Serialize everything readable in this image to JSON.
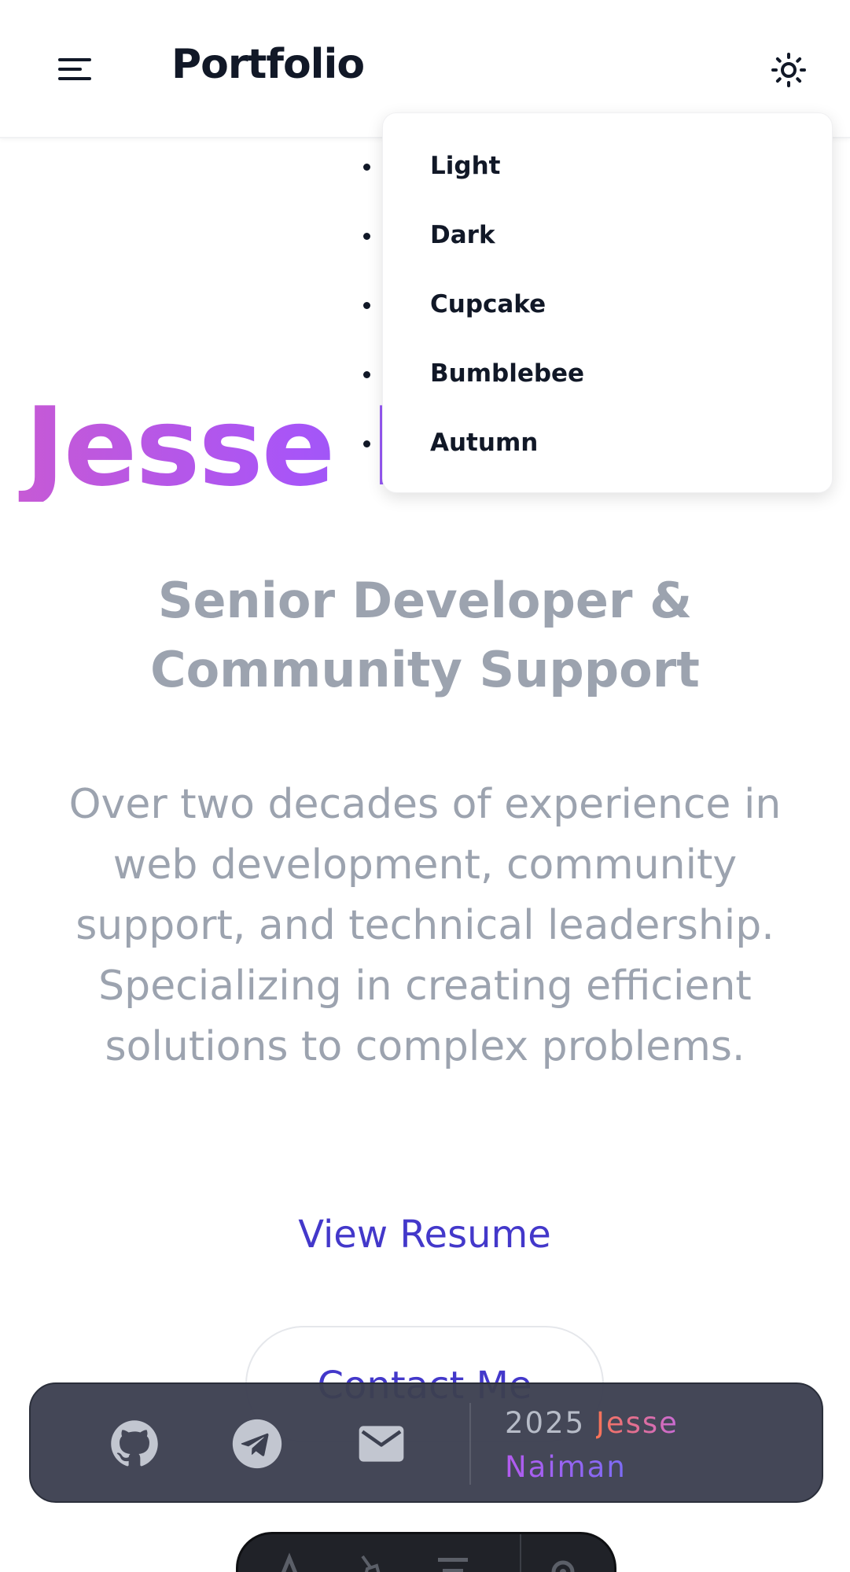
{
  "navbar": {
    "brand": "Portfolio",
    "menu_icon": "hamburger-menu-icon",
    "theme_icon": "sun-icon"
  },
  "theme_menu": {
    "items": [
      {
        "label": "Light"
      },
      {
        "label": "Dark"
      },
      {
        "label": "Cupcake"
      },
      {
        "label": "Bumblebee"
      },
      {
        "label": "Autumn"
      }
    ]
  },
  "hero": {
    "name": "Jesse Naiman",
    "title": "Senior Developer & Community Support",
    "description": "Over two decades of experience in web development, community support, and technical leadership. Specializing in creating efficient solutions to complex problems.",
    "primary_button": "View Resume",
    "secondary_button": "Contact Me"
  },
  "footer": {
    "icons": [
      "github-icon",
      "telegram-icon",
      "mail-icon"
    ],
    "year": "2025",
    "first_name": "Jesse",
    "last_name": "Naiman"
  },
  "colors": {
    "accent": "#4338ca",
    "gradient_start": "#c85ad3",
    "gradient_end": "#6366f1",
    "muted_text": "#9ca3af",
    "footer_bg": "#3c4050"
  }
}
